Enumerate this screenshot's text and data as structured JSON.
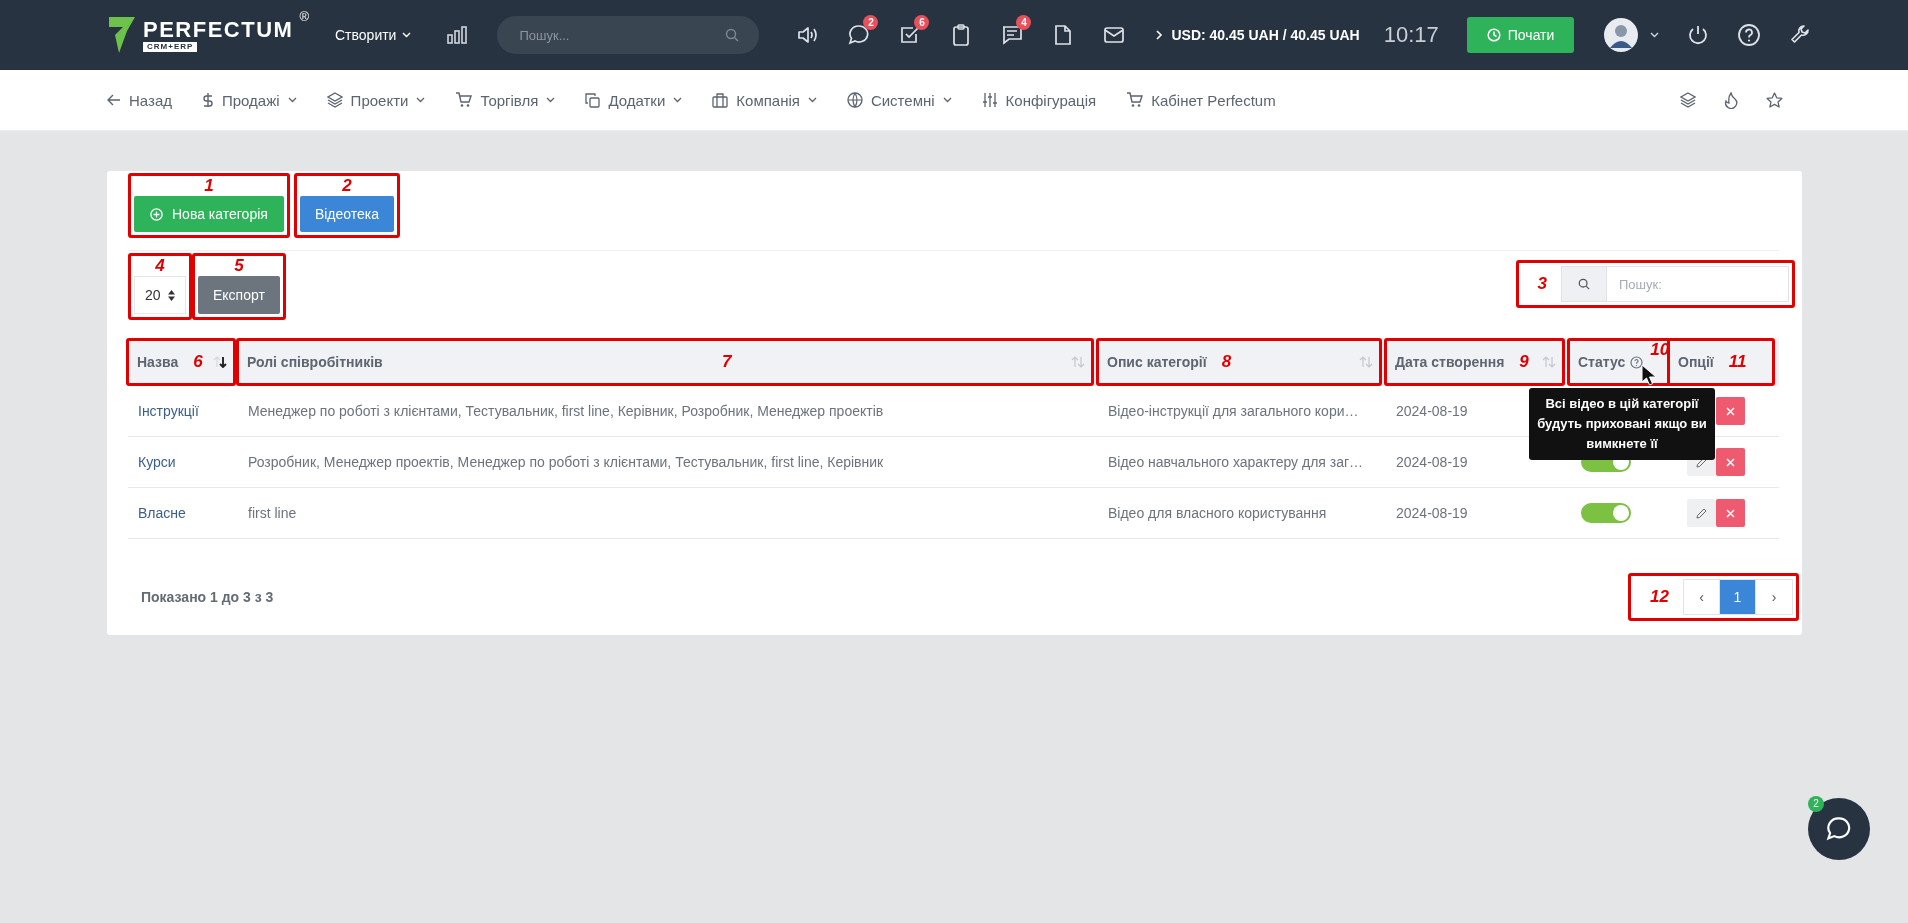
{
  "topbar": {
    "logo": "PERFECTUM",
    "logo_mark": "®",
    "logo_sub": "CRM+ERP",
    "create": "Створити",
    "search_placeholder": "Пошук...",
    "icons": [
      {
        "kind": "sound"
      },
      {
        "kind": "chat",
        "badge": "2"
      },
      {
        "kind": "tasks",
        "badge": "6"
      },
      {
        "kind": "clipboard"
      },
      {
        "kind": "messages",
        "badge": "4"
      },
      {
        "kind": "file"
      },
      {
        "kind": "mail"
      }
    ],
    "currency": "USD: 40.45 UAH / 40.45 UAH",
    "time": "10:17",
    "start": "Почати"
  },
  "nav": {
    "items": [
      {
        "kind": "back",
        "label": "Назад",
        "caret": false
      },
      {
        "kind": "dollar",
        "label": "Продажі",
        "caret": true
      },
      {
        "kind": "layers",
        "label": "Проекти",
        "caret": true
      },
      {
        "kind": "cart",
        "label": "Торгівля",
        "caret": true
      },
      {
        "kind": "copy",
        "label": "Додатки",
        "caret": true
      },
      {
        "kind": "briefcase",
        "label": "Компанія",
        "caret": true
      },
      {
        "kind": "globe",
        "label": "Системні",
        "caret": true
      },
      {
        "kind": "sliders",
        "label": "Конфігурація",
        "caret": false
      },
      {
        "kind": "cart",
        "label": "Кабінет Perfectum",
        "caret": false
      }
    ]
  },
  "card": {
    "buttons": [
      {
        "kind": "success",
        "label": "Нова категорія",
        "callout": "1"
      },
      {
        "kind": "info",
        "label": "Відеотека",
        "callout": "2"
      }
    ],
    "page_size": {
      "value": "20",
      "callout": "4"
    },
    "export": {
      "label": "Експорт",
      "callout": "5"
    },
    "search": {
      "placeholder": "Пошук:",
      "callout": "3"
    },
    "table": {
      "columns": [
        {
          "label": "Назва",
          "callout": "6",
          "sortable": true,
          "sorted": true,
          "help": false
        },
        {
          "label": "Ролі співробітників",
          "callout": "7",
          "sortable": true,
          "sorted": false,
          "help": false
        },
        {
          "label": "Опис категорії",
          "callout": "8",
          "sortable": true,
          "sorted": false,
          "help": false
        },
        {
          "label": "Дата створення",
          "callout": "9",
          "sortable": true,
          "sorted": false,
          "help": false
        },
        {
          "label": "Статус",
          "callout": "10",
          "sortable": false,
          "help": true
        },
        {
          "label": "Опції",
          "callout": "11",
          "sortable": false,
          "help": false
        }
      ],
      "rows": [
        {
          "name": "Інструкції",
          "roles": "Менеджер по роботі з клієнтами, Тестувальник, first line, Керівник, Розробник, Менеджер проектів",
          "description": "Відео-інструкції для загального кори…",
          "date": "2024-08-19",
          "actions": [
            {
              "kind": "delete"
            }
          ]
        },
        {
          "name": "Курси",
          "roles": "Розробник, Менеджер проектів, Менеджер по роботі з клієнтами, Тестувальник, first line, Керівник",
          "description": "Відео навчального характеру для заг…",
          "date": "2024-08-19",
          "on": true,
          "actions": [
            {
              "kind": "edit"
            },
            {
              "kind": "delete"
            }
          ]
        },
        {
          "name": "Власне",
          "roles": "first line",
          "description": "Відео для власного користування",
          "date": "2024-08-19",
          "on": true,
          "actions": [
            {
              "kind": "edit"
            },
            {
              "kind": "delete"
            }
          ]
        }
      ],
      "tooltip": "Всі відео в цій категорії будуть приховані якщо ви вимкнете її"
    },
    "info": "Показано 1 до 3 з 3",
    "pagination": {
      "prev": "‹",
      "next": "›",
      "pages": [
        {
          "label": "1",
          "selected": true
        }
      ],
      "callout": "12"
    }
  },
  "chat": {
    "badge": "2"
  }
}
